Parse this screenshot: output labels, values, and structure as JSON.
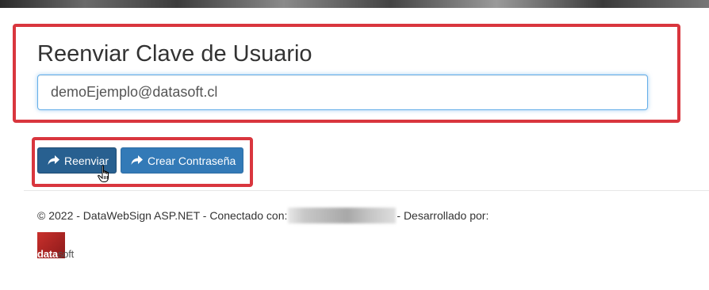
{
  "header": {
    "title": "Reenviar Clave de Usuario"
  },
  "form": {
    "email_value": "demoEjemplo@datasoft.cl"
  },
  "buttons": {
    "reenviar_label": "Reenviar",
    "crear_label": "Crear Contraseña"
  },
  "footer": {
    "copyright": "© 2022 - DataWebSign ASP.NET - Conectado con:",
    "developed_by": "- Desarrollado por:"
  },
  "logo": {
    "part1": "data",
    "part2": "soft"
  },
  "colors": {
    "primary_button": "#337ab7",
    "primary_button_active": "#286090",
    "highlight_border": "#d9363e",
    "logo_red": "#c9302c"
  }
}
